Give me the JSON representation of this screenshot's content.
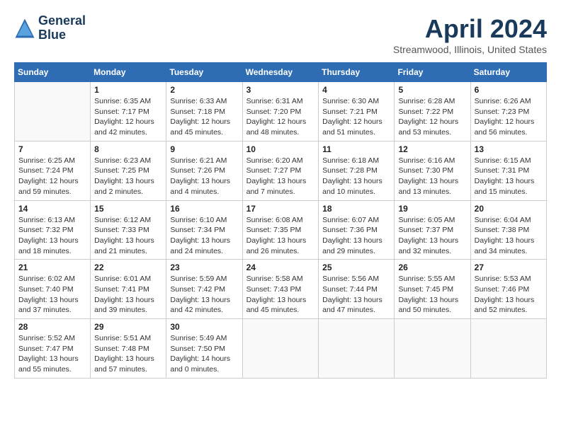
{
  "header": {
    "logo_line1": "General",
    "logo_line2": "Blue",
    "title": "April 2024",
    "subtitle": "Streamwood, Illinois, United States"
  },
  "columns": [
    "Sunday",
    "Monday",
    "Tuesday",
    "Wednesday",
    "Thursday",
    "Friday",
    "Saturday"
  ],
  "weeks": [
    [
      {
        "day": "",
        "sunrise": "",
        "sunset": "",
        "daylight": ""
      },
      {
        "day": "1",
        "sunrise": "Sunrise: 6:35 AM",
        "sunset": "Sunset: 7:17 PM",
        "daylight": "Daylight: 12 hours and 42 minutes."
      },
      {
        "day": "2",
        "sunrise": "Sunrise: 6:33 AM",
        "sunset": "Sunset: 7:18 PM",
        "daylight": "Daylight: 12 hours and 45 minutes."
      },
      {
        "day": "3",
        "sunrise": "Sunrise: 6:31 AM",
        "sunset": "Sunset: 7:20 PM",
        "daylight": "Daylight: 12 hours and 48 minutes."
      },
      {
        "day": "4",
        "sunrise": "Sunrise: 6:30 AM",
        "sunset": "Sunset: 7:21 PM",
        "daylight": "Daylight: 12 hours and 51 minutes."
      },
      {
        "day": "5",
        "sunrise": "Sunrise: 6:28 AM",
        "sunset": "Sunset: 7:22 PM",
        "daylight": "Daylight: 12 hours and 53 minutes."
      },
      {
        "day": "6",
        "sunrise": "Sunrise: 6:26 AM",
        "sunset": "Sunset: 7:23 PM",
        "daylight": "Daylight: 12 hours and 56 minutes."
      }
    ],
    [
      {
        "day": "7",
        "sunrise": "Sunrise: 6:25 AM",
        "sunset": "Sunset: 7:24 PM",
        "daylight": "Daylight: 12 hours and 59 minutes."
      },
      {
        "day": "8",
        "sunrise": "Sunrise: 6:23 AM",
        "sunset": "Sunset: 7:25 PM",
        "daylight": "Daylight: 13 hours and 2 minutes."
      },
      {
        "day": "9",
        "sunrise": "Sunrise: 6:21 AM",
        "sunset": "Sunset: 7:26 PM",
        "daylight": "Daylight: 13 hours and 4 minutes."
      },
      {
        "day": "10",
        "sunrise": "Sunrise: 6:20 AM",
        "sunset": "Sunset: 7:27 PM",
        "daylight": "Daylight: 13 hours and 7 minutes."
      },
      {
        "day": "11",
        "sunrise": "Sunrise: 6:18 AM",
        "sunset": "Sunset: 7:28 PM",
        "daylight": "Daylight: 13 hours and 10 minutes."
      },
      {
        "day": "12",
        "sunrise": "Sunrise: 6:16 AM",
        "sunset": "Sunset: 7:30 PM",
        "daylight": "Daylight: 13 hours and 13 minutes."
      },
      {
        "day": "13",
        "sunrise": "Sunrise: 6:15 AM",
        "sunset": "Sunset: 7:31 PM",
        "daylight": "Daylight: 13 hours and 15 minutes."
      }
    ],
    [
      {
        "day": "14",
        "sunrise": "Sunrise: 6:13 AM",
        "sunset": "Sunset: 7:32 PM",
        "daylight": "Daylight: 13 hours and 18 minutes."
      },
      {
        "day": "15",
        "sunrise": "Sunrise: 6:12 AM",
        "sunset": "Sunset: 7:33 PM",
        "daylight": "Daylight: 13 hours and 21 minutes."
      },
      {
        "day": "16",
        "sunrise": "Sunrise: 6:10 AM",
        "sunset": "Sunset: 7:34 PM",
        "daylight": "Daylight: 13 hours and 24 minutes."
      },
      {
        "day": "17",
        "sunrise": "Sunrise: 6:08 AM",
        "sunset": "Sunset: 7:35 PM",
        "daylight": "Daylight: 13 hours and 26 minutes."
      },
      {
        "day": "18",
        "sunrise": "Sunrise: 6:07 AM",
        "sunset": "Sunset: 7:36 PM",
        "daylight": "Daylight: 13 hours and 29 minutes."
      },
      {
        "day": "19",
        "sunrise": "Sunrise: 6:05 AM",
        "sunset": "Sunset: 7:37 PM",
        "daylight": "Daylight: 13 hours and 32 minutes."
      },
      {
        "day": "20",
        "sunrise": "Sunrise: 6:04 AM",
        "sunset": "Sunset: 7:38 PM",
        "daylight": "Daylight: 13 hours and 34 minutes."
      }
    ],
    [
      {
        "day": "21",
        "sunrise": "Sunrise: 6:02 AM",
        "sunset": "Sunset: 7:40 PM",
        "daylight": "Daylight: 13 hours and 37 minutes."
      },
      {
        "day": "22",
        "sunrise": "Sunrise: 6:01 AM",
        "sunset": "Sunset: 7:41 PM",
        "daylight": "Daylight: 13 hours and 39 minutes."
      },
      {
        "day": "23",
        "sunrise": "Sunrise: 5:59 AM",
        "sunset": "Sunset: 7:42 PM",
        "daylight": "Daylight: 13 hours and 42 minutes."
      },
      {
        "day": "24",
        "sunrise": "Sunrise: 5:58 AM",
        "sunset": "Sunset: 7:43 PM",
        "daylight": "Daylight: 13 hours and 45 minutes."
      },
      {
        "day": "25",
        "sunrise": "Sunrise: 5:56 AM",
        "sunset": "Sunset: 7:44 PM",
        "daylight": "Daylight: 13 hours and 47 minutes."
      },
      {
        "day": "26",
        "sunrise": "Sunrise: 5:55 AM",
        "sunset": "Sunset: 7:45 PM",
        "daylight": "Daylight: 13 hours and 50 minutes."
      },
      {
        "day": "27",
        "sunrise": "Sunrise: 5:53 AM",
        "sunset": "Sunset: 7:46 PM",
        "daylight": "Daylight: 13 hours and 52 minutes."
      }
    ],
    [
      {
        "day": "28",
        "sunrise": "Sunrise: 5:52 AM",
        "sunset": "Sunset: 7:47 PM",
        "daylight": "Daylight: 13 hours and 55 minutes."
      },
      {
        "day": "29",
        "sunrise": "Sunrise: 5:51 AM",
        "sunset": "Sunset: 7:48 PM",
        "daylight": "Daylight: 13 hours and 57 minutes."
      },
      {
        "day": "30",
        "sunrise": "Sunrise: 5:49 AM",
        "sunset": "Sunset: 7:50 PM",
        "daylight": "Daylight: 14 hours and 0 minutes."
      },
      {
        "day": "",
        "sunrise": "",
        "sunset": "",
        "daylight": ""
      },
      {
        "day": "",
        "sunrise": "",
        "sunset": "",
        "daylight": ""
      },
      {
        "day": "",
        "sunrise": "",
        "sunset": "",
        "daylight": ""
      },
      {
        "day": "",
        "sunrise": "",
        "sunset": "",
        "daylight": ""
      }
    ]
  ]
}
